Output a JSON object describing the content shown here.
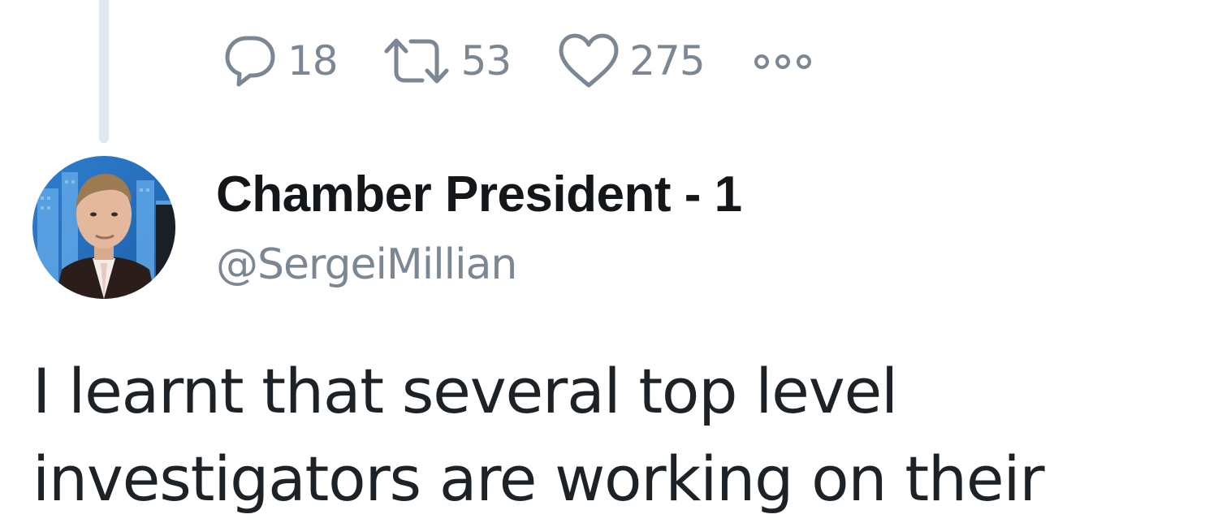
{
  "tweet_actions": {
    "reply": {
      "icon": "speech-bubble-icon",
      "count": "18"
    },
    "retweet": {
      "icon": "retweet-icon",
      "count": "53"
    },
    "like": {
      "icon": "heart-icon",
      "count": "275"
    },
    "more": {
      "icon": "more-dots-icon"
    }
  },
  "reply_tweet": {
    "author": {
      "display_name": "Chamber President - 1",
      "handle": "@SergeiMillian"
    },
    "text_lines": [
      "I learnt that several top level",
      "investigators are working on their"
    ]
  },
  "colors": {
    "muted": "#7b8793",
    "text": "#14171a",
    "thread_line": "#e1e8ed"
  }
}
